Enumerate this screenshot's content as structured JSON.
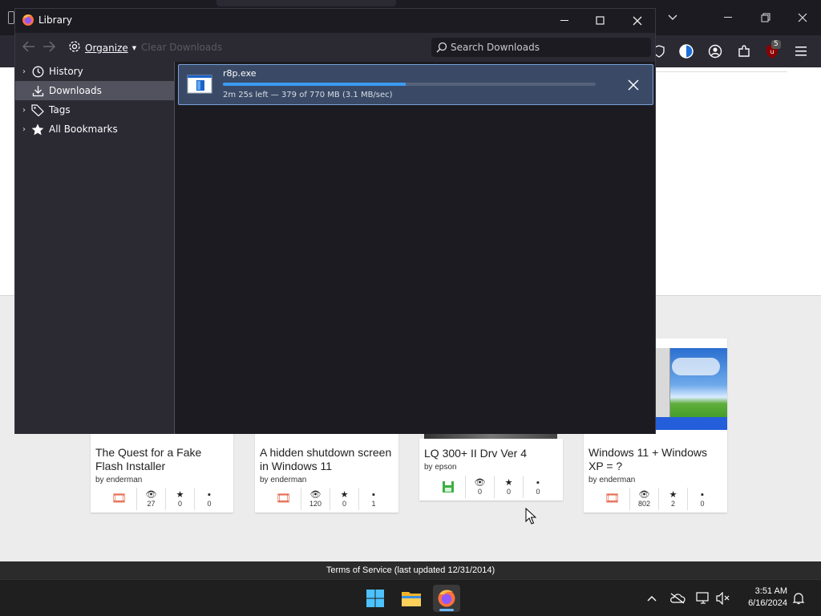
{
  "library": {
    "title": "Library",
    "toolbar": {
      "organize_label": "Organize",
      "clear_downloads_label": "Clear Downloads",
      "search_placeholder": "Search Downloads"
    },
    "sidebar": {
      "items": [
        {
          "label": "History",
          "icon": "clock-icon",
          "expandable": true
        },
        {
          "label": "Downloads",
          "icon": "download-icon",
          "expandable": false,
          "selected": true
        },
        {
          "label": "Tags",
          "icon": "tag-icon",
          "expandable": true
        },
        {
          "label": "All Bookmarks",
          "icon": "star-icon",
          "expandable": true
        }
      ]
    },
    "download": {
      "file_name": "r8p.exe",
      "status": "2m 25s left — 379 of 770 MB (3.1 MB/sec)",
      "progress_fraction": 0.49
    }
  },
  "browser": {
    "extension_badge": "5"
  },
  "page": {
    "cards": [
      {
        "title": "The Quest for a Fake Flash Installer",
        "author": "by enderman",
        "type_icon": "film-icon",
        "views": "27",
        "stars": "0",
        "comments": "0"
      },
      {
        "title": "A hidden shutdown screen in Windows 11",
        "author": "by enderman",
        "type_icon": "film-icon",
        "views": "120",
        "stars": "0",
        "comments": "1"
      },
      {
        "title": "LQ 300+ II Drv Ver 4",
        "author": "by epson",
        "type_icon": "floppy-icon",
        "views": "0",
        "stars": "0",
        "comments": "0"
      },
      {
        "title": "Windows 11 + Windows XP = ?",
        "author": "by enderman",
        "type_icon": "film-icon",
        "views": "802",
        "stars": "2",
        "comments": "0"
      }
    ],
    "footer": "Terms of Service (last updated 12/31/2014)"
  },
  "taskbar": {
    "time": "3:51 AM",
    "date": "6/16/2024"
  },
  "colors": {
    "accent": "#3c9cf0",
    "download_row": "#3a4a66",
    "sidebar_selected": "#52525e"
  }
}
